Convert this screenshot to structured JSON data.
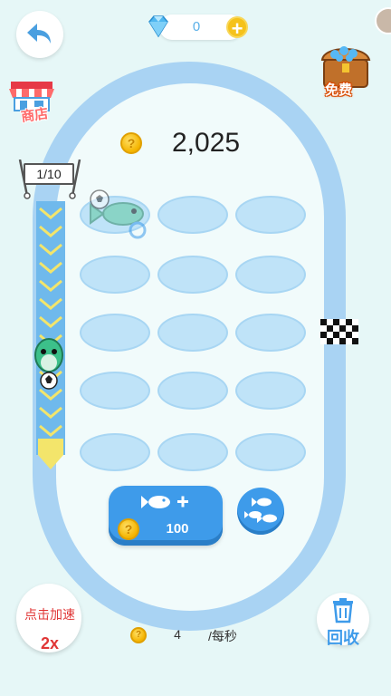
{
  "header": {
    "gem_count": "0",
    "add_gem": "+"
  },
  "shop": {
    "label": "商店"
  },
  "chest": {
    "label": "免费"
  },
  "score": {
    "value": "2,025",
    "coin_symbol": "?"
  },
  "counter": {
    "text": "1/10"
  },
  "buy": {
    "price": "100",
    "coin_symbol": "?"
  },
  "speed": {
    "label": "点击加速",
    "multiplier": "2x"
  },
  "recycle": {
    "label": "回收"
  },
  "income": {
    "value": "4",
    "unit": "/每秒",
    "coin_symbol": "?"
  },
  "colors": {
    "background": "#e6f7f7",
    "track": "#a9d3f3",
    "button_blue": "#3e9bea",
    "coin_gold": "#f4b400",
    "lane_chevron": "#f3e56b"
  }
}
